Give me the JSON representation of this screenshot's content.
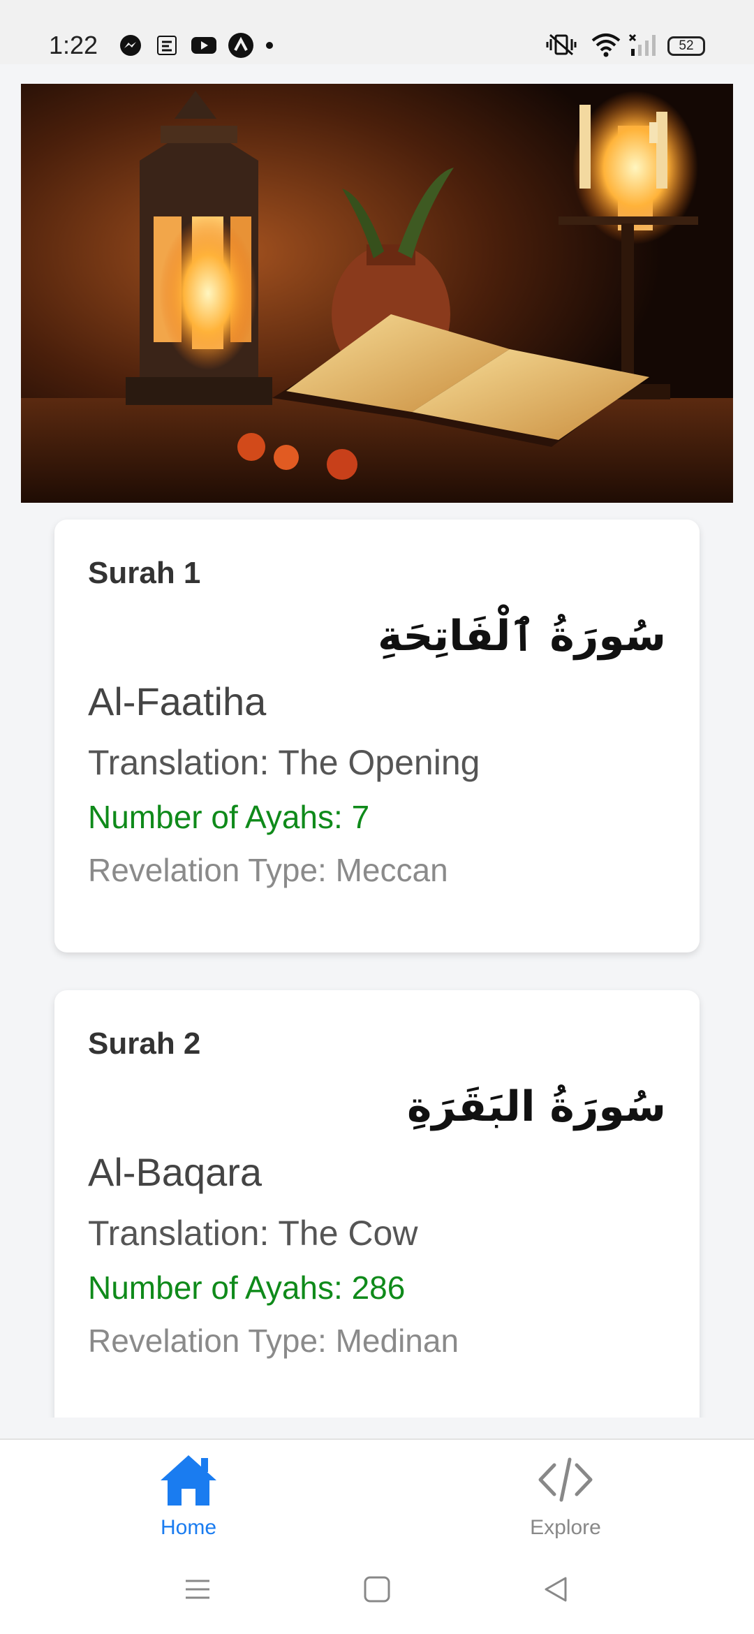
{
  "status_bar": {
    "time": "1:22",
    "battery": "52",
    "left_icons": [
      "messenger-icon",
      "quran-app-icon",
      "youtube-icon",
      "vpn-icon",
      "dot-icon"
    ],
    "right_icons": [
      "vibrate-mute-icon",
      "wifi-icon",
      "signal-icon",
      "battery-icon"
    ]
  },
  "hero": {
    "image": "lantern-candles-quran-photo"
  },
  "surahs": [
    {
      "title": "Surah 1",
      "arabic": "سُورَةُ ٱلْفَاتِحَةِ",
      "name": "Al-Faatiha",
      "translation": "Translation: The Opening",
      "ayahs": "Number of Ayahs: 7",
      "revelation": "Revelation Type: Meccan"
    },
    {
      "title": "Surah 2",
      "arabic": "سُورَةُ البَقَرَةِ",
      "name": "Al-Baqara",
      "translation": "Translation: The Cow",
      "ayahs": "Number of Ayahs: 286",
      "revelation": "Revelation Type: Medinan"
    }
  ],
  "bottom_nav": {
    "home_label": "Home",
    "explore_label": "Explore",
    "active_color": "#1a7cf0",
    "inactive_color": "#888888"
  },
  "colors": {
    "ayahs_text": "#0f8a1a",
    "revelation_text": "#8a8a8a"
  }
}
